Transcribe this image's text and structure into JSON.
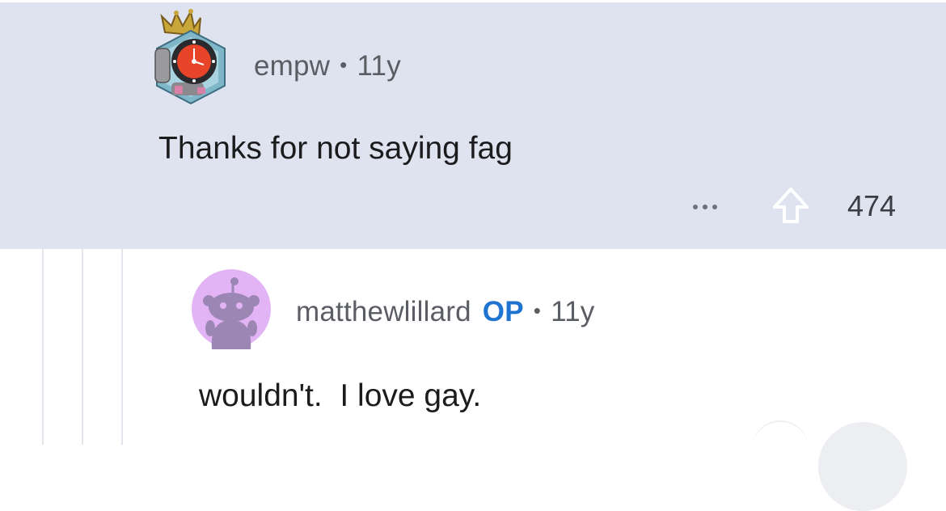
{
  "comments": [
    {
      "author": "empw",
      "separator": "•",
      "age": "11y",
      "body": "Thanks for not saying fag",
      "more_label": "•••",
      "score": "474",
      "avatar_icon": "crowned-watch-avatar-icon"
    },
    {
      "author": "matthewlillard",
      "op_badge": "OP",
      "separator": "•",
      "age": "11y",
      "body": "wouldn't.  I love gay.",
      "avatar_icon": "snoo-avatar-icon"
    }
  ],
  "colors": {
    "highlight_bg": "#dfe3ef",
    "op_blue": "#1f74d1",
    "avatar_purple_bg": "#e3b4f5",
    "avatar_purple_fg": "#9c86b4",
    "watch_orange": "#e8442a",
    "avatar_teal": "#7fb6c8"
  }
}
